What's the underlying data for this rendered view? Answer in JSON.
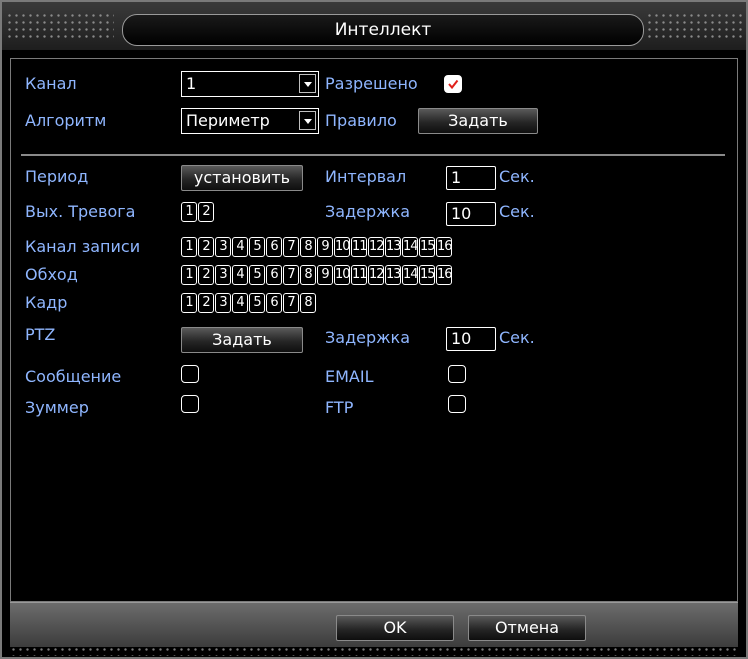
{
  "window": {
    "title": "Интеллект",
    "ok_label": "OK",
    "cancel_label": "Отмена"
  },
  "top": {
    "channel_label": "Канал",
    "channel_value": "1",
    "enabled_label": "Разрешено",
    "enabled_checked": true,
    "algorithm_label": "Алгоритм",
    "algorithm_value": "Периметр",
    "rule_label": "Правило",
    "rule_button": "Задать"
  },
  "settings": {
    "period_label": "Период",
    "period_button": "установить",
    "interval_label": "Интервал",
    "interval_value": "1",
    "interval_unit": "Сек.",
    "alarm_out_label": "Вых. Тревога",
    "alarm_out_boxes": [
      "1",
      "2"
    ],
    "delay_label": "Задержка",
    "delay_value": "10",
    "delay_unit": "Сек.",
    "record_channel_label": "Канал записи",
    "record_channel_boxes": [
      "1",
      "2",
      "3",
      "4",
      "5",
      "6",
      "7",
      "8",
      "9",
      "10",
      "11",
      "12",
      "13",
      "14",
      "15",
      "16"
    ],
    "tour_label": "Обход",
    "tour_boxes": [
      "1",
      "2",
      "3",
      "4",
      "5",
      "6",
      "7",
      "8",
      "9",
      "10",
      "11",
      "12",
      "13",
      "14",
      "15",
      "16"
    ],
    "frame_label": "Кадр",
    "frame_boxes": [
      "1",
      "2",
      "3",
      "4",
      "5",
      "6",
      "7",
      "8"
    ],
    "ptz_label": "PTZ",
    "ptz_button": "Задать",
    "ptz_delay_label": "Задержка",
    "ptz_delay_value": "10",
    "ptz_delay_unit": "Сек.",
    "message_label": "Сообщение",
    "email_label": "EMAIL",
    "buzzer_label": "Зуммер",
    "ftp_label": "FTP"
  }
}
